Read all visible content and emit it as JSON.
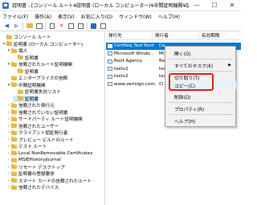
{
  "window": {
    "title": "証明書 - [コンソール ルート¥証明書 (ローカル コンピューター)¥中間証明機関¥証明書]",
    "buttons": [
      "—",
      "☐",
      "✕"
    ]
  },
  "menu": [
    "ファイル(F)",
    "操作(A)",
    "表示(V)",
    "お気に入り(O)",
    "ウィンドウ(W)",
    "ヘルプ(H)"
  ],
  "tree": [
    {
      "label": "コンソール ルート",
      "level": 0,
      "twisty": ""
    },
    {
      "label": "証明書 (ローカル コンピューター)",
      "level": 1,
      "twisty": "▾"
    },
    {
      "label": "個人",
      "level": 2,
      "twisty": "▾"
    },
    {
      "label": "証明書",
      "level": 3,
      "twisty": ""
    },
    {
      "label": "信頼されたルート証明機関",
      "level": 2,
      "twisty": "▾"
    },
    {
      "label": "証明書",
      "level": 3,
      "twisty": ""
    },
    {
      "label": "エンタープライズの信頼",
      "level": 2,
      "twisty": ""
    },
    {
      "label": "中間証明機関",
      "level": 2,
      "twisty": "▾"
    },
    {
      "label": "証明書失効リスト",
      "level": 3,
      "twisty": ""
    },
    {
      "label": "証明書",
      "level": 3,
      "twisty": "",
      "selected": true
    },
    {
      "label": "信頼された発行元",
      "level": 2,
      "twisty": "›"
    },
    {
      "label": "信頼されていない証明書",
      "level": 2,
      "twisty": "›"
    },
    {
      "label": "サードパーティ ルート証明機関",
      "level": 2,
      "twisty": "›"
    },
    {
      "label": "信頼されたユーザー",
      "level": 2,
      "twisty": "›"
    },
    {
      "label": "クライアント認証発行者",
      "level": 2,
      "twisty": "›"
    },
    {
      "label": "プレビュー ビルドのルート",
      "level": 2,
      "twisty": "›"
    },
    {
      "label": "テスト ルート",
      "level": 2,
      "twisty": "›"
    },
    {
      "label": "Local NonRemovable Certificates",
      "level": 2,
      "twisty": "›"
    },
    {
      "label": "MSIEHistoryJournal",
      "level": 2,
      "twisty": "›"
    },
    {
      "label": "リモート デスクトップ",
      "level": 2,
      "twisty": "›"
    },
    {
      "label": "証明書の登録要求",
      "level": 2,
      "twisty": "›"
    },
    {
      "label": "スマート カードの信頼されたルート",
      "level": 2,
      "twisty": "›"
    },
    {
      "label": "信頼されたデバイス",
      "level": 2,
      "twisty": "›"
    }
  ],
  "list": {
    "columns": [
      "発行先",
      "発行者",
      "有効期限"
    ],
    "rows": [
      {
        "issued_to": "CertReq Test Root",
        "issued_by": "Ce",
        "selected": true
      },
      {
        "issued_to": "Microsoft Windo...",
        "issued_by": "Mi",
        "selected": false
      },
      {
        "issued_to": "Root Agency",
        "issued_by": "Ro",
        "selected": false
      },
      {
        "issued_to": "testv2",
        "issued_by": "tes",
        "selected": false
      },
      {
        "issued_to": "testv2",
        "issued_by": "tes",
        "selected": false
      },
      {
        "issued_to": "www.verisign.com...",
        "issued_by": "Cl",
        "selected": false
      }
    ]
  },
  "context_menu": {
    "items": [
      {
        "label": "開く(O)",
        "submenu": false
      },
      {
        "label": "すべてのタスク(K)",
        "submenu": true
      },
      {
        "label": "切り取り(T)",
        "submenu": false
      },
      {
        "label": "コピー(C)",
        "submenu": false,
        "highlighted": true
      },
      {
        "label": "削除(D)",
        "submenu": false
      },
      {
        "label": "プロパティ(R)",
        "submenu": false
      },
      {
        "label": "ヘルプ(H)",
        "submenu": false
      }
    ]
  },
  "colors": {
    "selection": "#0078d7",
    "tree_selection": "#cce8ff",
    "highlight_box": "#e02020",
    "folder": "#e8b949"
  }
}
